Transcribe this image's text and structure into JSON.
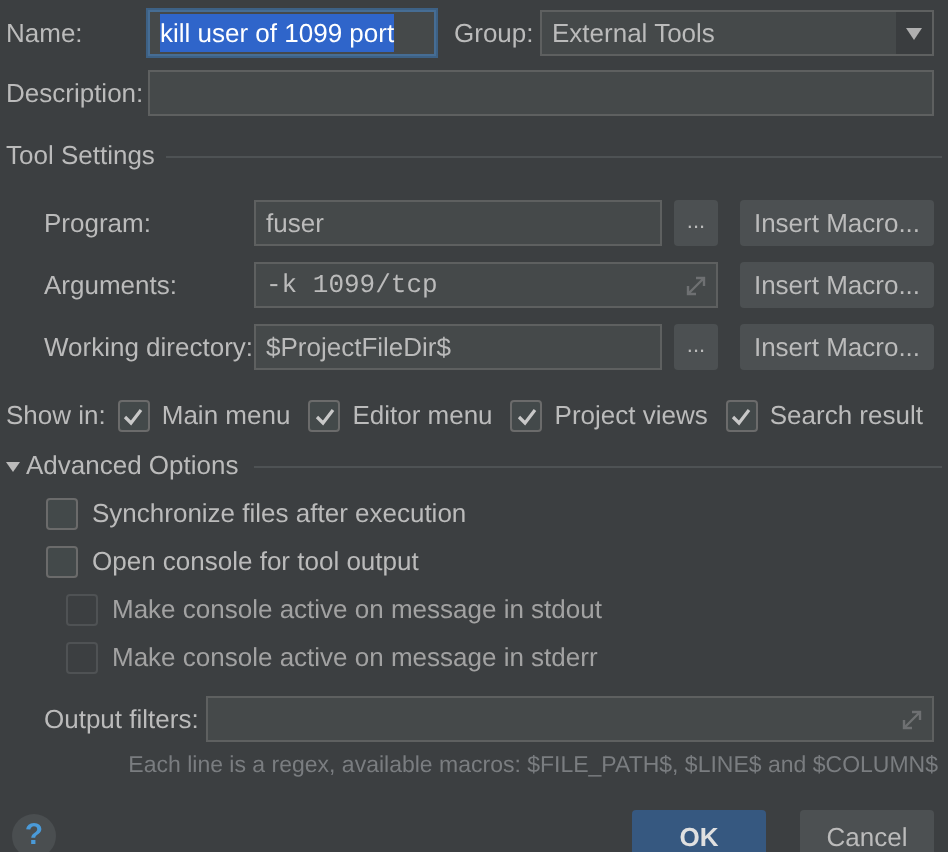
{
  "name": {
    "label": "Name:",
    "value": "kill user of 1099 port",
    "text_selected": true
  },
  "group": {
    "label": "Group:",
    "value": "External Tools"
  },
  "description": {
    "label": "Description:"
  },
  "tool_settings": {
    "title": "Tool Settings",
    "rows": [
      {
        "label": "Program:",
        "value": "fuser",
        "kind": "browse",
        "browse": "...",
        "macro": "Insert Macro..."
      },
      {
        "label": "Arguments:",
        "value": "-k 1099/tcp",
        "kind": "expand",
        "macro": "Insert Macro..."
      },
      {
        "label": "Working directory:",
        "value": "$ProjectFileDir$",
        "kind": "browse",
        "browse": "...",
        "macro": "Insert Macro..."
      }
    ]
  },
  "show_in": {
    "label": "Show in:",
    "options": [
      {
        "label": "Main menu",
        "checked": true
      },
      {
        "label": "Editor menu",
        "checked": true
      },
      {
        "label": "Project views",
        "checked": true
      },
      {
        "label": "Search result",
        "checked": true
      }
    ]
  },
  "advanced": {
    "title": "Advanced Options",
    "expanded": true,
    "options": [
      {
        "label": "Synchronize files after execution",
        "checked": false,
        "disabled": false
      },
      {
        "label": "Open console for tool output",
        "checked": false,
        "disabled": false,
        "children": [
          {
            "label": "Make console active on message in stdout",
            "checked": false,
            "disabled": true
          },
          {
            "label": "Make console active on message in stderr",
            "checked": false,
            "disabled": true
          }
        ]
      }
    ]
  },
  "output_filters": {
    "label": "Output filters:",
    "hint": "Each line is a regex, available macros: $FILE_PATH$, $LINE$ and $COLUMN$"
  },
  "buttons": [
    {
      "label": "OK",
      "default": true
    },
    {
      "label": "Cancel",
      "default": false
    }
  ],
  "help": "?"
}
